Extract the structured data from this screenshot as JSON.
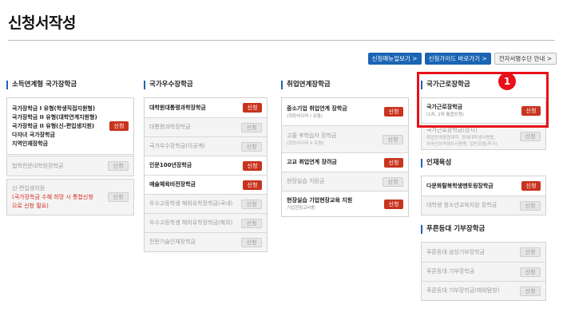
{
  "page": {
    "title": "신청서작성"
  },
  "top_buttons": [
    "신청매뉴얼보기 >",
    "신청가이드 바로가기 >",
    "전자서명수단 안내 >"
  ],
  "callout_number": "1",
  "columns": [
    {
      "title": "소득연계형 국가장학금",
      "groups": [
        {
          "items": [
            {
              "lines": [
                "국가장학금 I 유형(학생직접지원형)",
                "국가장학금 II 유형(대학연계지원형)",
                "국가장학금 II 유형(신-편입생지원)",
                "다자녀 국가장학금",
                "지역인재장학금"
              ],
              "badge": "신청",
              "active": true
            }
          ]
        },
        {
          "items": [
            {
              "text": "법학전문대학원장학금",
              "badge": "신청",
              "active": false
            }
          ]
        },
        {
          "items": [
            {
              "text": "신-편입생지원",
              "red": "(국가장학금 수혜 희망 시 통합신청으로 신청 필요)",
              "badge": "신청",
              "active": false
            }
          ]
        }
      ]
    },
    {
      "title": "국가우수장학금",
      "groups": [
        {
          "items": [
            {
              "text": "대학원대통령과학장학금",
              "badge": "신청",
              "active": true
            },
            {
              "text": "대통령과학장학금",
              "badge": "신청",
              "active": false
            },
            {
              "text": "국가우수장학금(이공계)",
              "badge": "신청",
              "active": false
            },
            {
              "text": "인문100년장학금",
              "badge": "신청",
              "active": true
            },
            {
              "text": "예술체육비전장학금",
              "badge": "신청",
              "active": true
            },
            {
              "text": "우수고등학생 해외유학장학금(국내)",
              "badge": "신청",
              "active": false
            },
            {
              "text": "우수고등학생 해외유학장학금(해외)",
              "badge": "신청",
              "active": false
            },
            {
              "text": "전문기술인재장학금",
              "badge": "신청",
              "active": false
            }
          ]
        }
      ]
    },
    {
      "title": "취업연계장학금",
      "groups": [
        {
          "items": [
            {
              "text": "중소기업 취업연계 장학금",
              "sub": "(희망사다리 I 유형)",
              "badge": "신청",
              "active": true
            },
            {
              "text": "고졸 후학습자 장학금",
              "sub": "(희망사다리 II 유형)",
              "badge": "신청",
              "active": false
            },
            {
              "text": "고교 취업연계 장려금",
              "badge": "신청",
              "active": true
            },
            {
              "text": "현장실습 지원금",
              "badge": "신청",
              "active": false
            },
            {
              "text": "현장실습 기업현장교육 지원",
              "sub": "기업현장교사용",
              "badge": "신청",
              "active": true
            }
          ]
        }
      ]
    },
    {
      "sections": [
        {
          "title": "국가근로장학금",
          "items": [
            {
              "text": "국가근로장학금",
              "sub": "(1차, 2차 통합신청)",
              "badge": "신청",
              "active": true
            },
            {
              "text": "국가근로장학금(상시)",
              "subs": [
                "취업연계중점대학, 장애대학생사용용,",
                "외국인유학생도사용용, 일반유형(추가)"
              ],
              "badge": "신청",
              "active": false
            }
          ]
        },
        {
          "title": "인재육성",
          "items": [
            {
              "text": "다문화탈북학생멘토링장학금",
              "badge": "신청",
              "active": true
            },
            {
              "text": "대학생 청소년교육지원 장학금",
              "badge": "신청",
              "active": false
            }
          ]
        },
        {
          "title": "푸른등대 기부장학금",
          "items": [
            {
              "text": "푸른등대 삼성기부장학금",
              "badge": "신청",
              "active": false
            },
            {
              "text": "푸른등대 기부장학금",
              "badge": "신청",
              "active": false
            },
            {
              "text": "푸른등대 기부장학금(해외탐방)",
              "badge": "신청",
              "active": false
            }
          ]
        }
      ]
    }
  ]
}
